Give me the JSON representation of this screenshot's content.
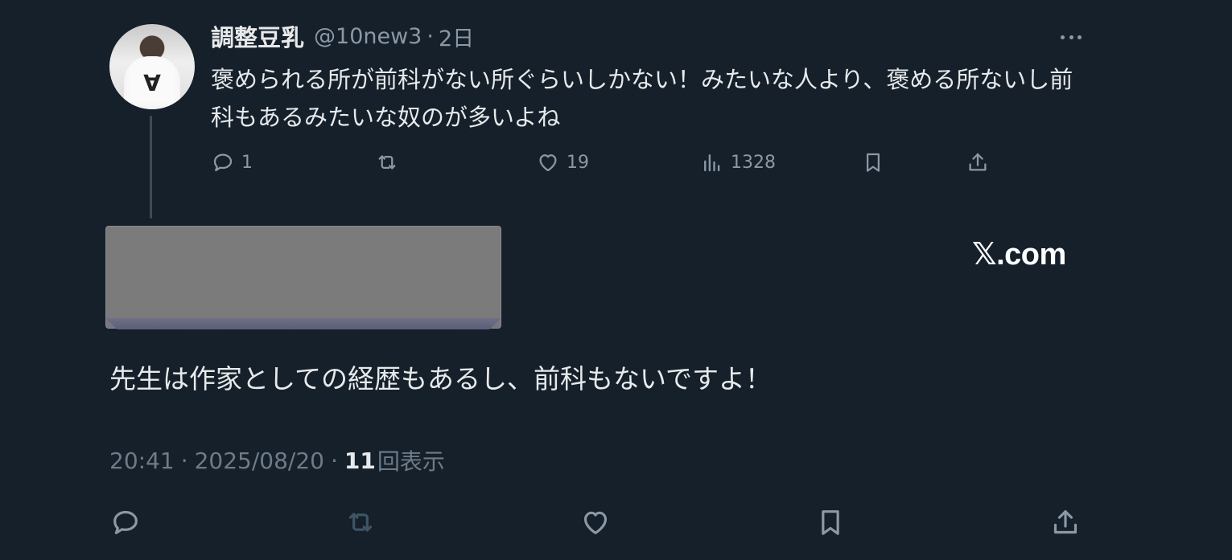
{
  "quoted_tweet": {
    "author_name": "調整豆乳",
    "handle": "@10new3",
    "separator": "·",
    "relative_time": "2日",
    "text": "褒められる所が前科がない所ぐらいしかない！みたいな人より、褒める所ないし前科もあるみたいな奴のが多いよね",
    "reply_count": "1",
    "retweet_count": "",
    "like_count": "19",
    "view_count": "1328",
    "avatar_glyph": "A"
  },
  "card": {
    "domain_label": "𝕏.com"
  },
  "main_tweet": {
    "text": "先生は作家としての経歴もあるし、前科もないですよ！",
    "time": "20:41",
    "date": "2025/08/20",
    "separator": "·",
    "views_count": "11",
    "views_label": "回表示"
  },
  "colors": {
    "background": "#15202b",
    "text_primary": "#e7e9ea",
    "text_secondary": "#8b98a5",
    "icon_muted": "#8b98a5",
    "retweet_disabled": "#3f5566"
  },
  "icons": {
    "reply": "reply-icon",
    "retweet": "retweet-icon",
    "like": "heart-icon",
    "views": "analytics-icon",
    "bookmark": "bookmark-icon",
    "share": "share-icon",
    "more": "more-icon"
  }
}
